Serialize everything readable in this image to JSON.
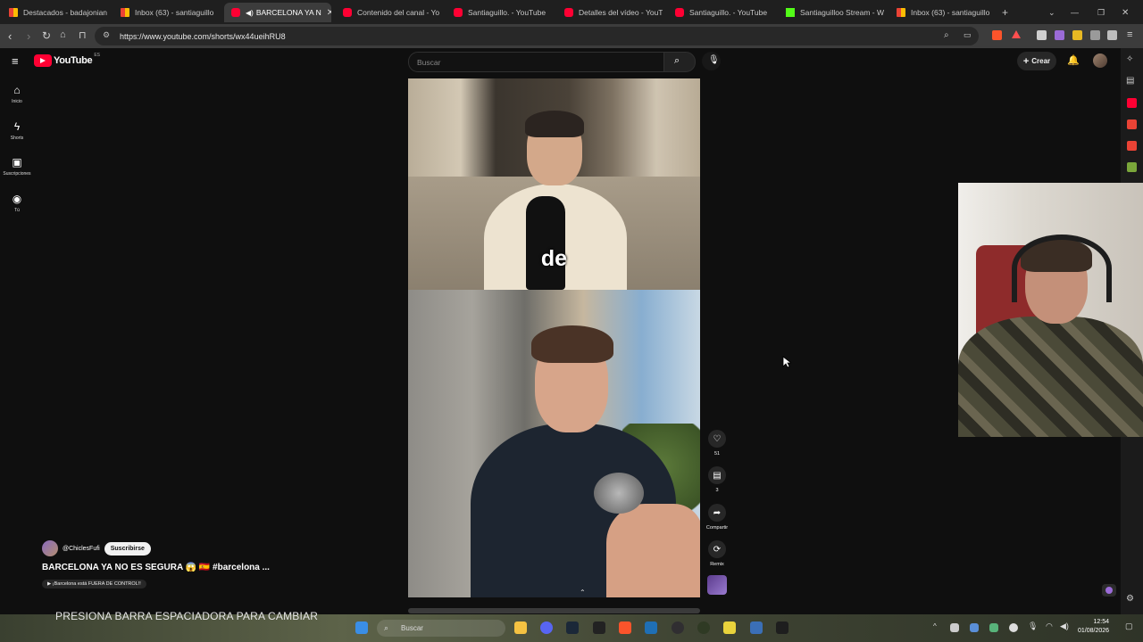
{
  "browser": {
    "tabs": [
      {
        "label": "Destacados - badajonian",
        "icon": "gmail"
      },
      {
        "label": "Inbox (63) - santiaguillo",
        "icon": "gmail"
      },
      {
        "label": "BARCELONA YA N",
        "icon": "youtube",
        "active": true
      },
      {
        "label": "Contenido del canal - Yo",
        "icon": "youtube"
      },
      {
        "label": "Santiaguillo. - YouTube",
        "icon": "youtube"
      },
      {
        "label": "Detalles del vídeo - YouTu",
        "icon": "youtube"
      },
      {
        "label": "Santiaguillo. - YouTube",
        "icon": "youtube"
      },
      {
        "label": "Santiaguilloo Stream - W",
        "icon": "kick"
      },
      {
        "label": "Inbox (63) - santiaguillo",
        "icon": "gmail"
      }
    ],
    "new_tab": "+",
    "url": "https://www.youtube.com/shorts/wx44ueihRU8"
  },
  "youtube": {
    "logo_text": "YouTube",
    "logo_country": "ES",
    "search_placeholder": "Buscar",
    "create_label": "Crear",
    "sidebar": [
      {
        "label": "Inicio",
        "icon": "home-icon"
      },
      {
        "label": "Shorts",
        "icon": "shorts-icon"
      },
      {
        "label": "Suscripciones",
        "icon": "subscriptions-icon"
      },
      {
        "label": "Tú",
        "icon": "you-icon"
      }
    ]
  },
  "short": {
    "caption": "de",
    "channel": "@ChiclesFufi",
    "subscribe_label": "Suscribirse",
    "title": "BARCELONA YA NO ES SEGURA 😱 🇪🇸 #barcelona ...",
    "pill": "▶ ¡Barcelona está FUERA DE CONTROL!!",
    "actions": [
      {
        "name": "like",
        "icon": "heart-icon",
        "label": "51"
      },
      {
        "name": "comments",
        "icon": "comment-icon",
        "label": "3"
      },
      {
        "name": "share",
        "icon": "share-icon",
        "label": "Compartir"
      },
      {
        "name": "remix",
        "icon": "remix-icon",
        "label": "Remix"
      }
    ]
  },
  "taskbar": {
    "banner": "PRESIONA BARRA ESPACIADORA PARA CAMBIAR",
    "search": "Buscar",
    "time": "12:54",
    "date": "01/08/2026"
  },
  "colors": {
    "youtube_red": "#ff0033",
    "background": "#0f0f0f"
  }
}
